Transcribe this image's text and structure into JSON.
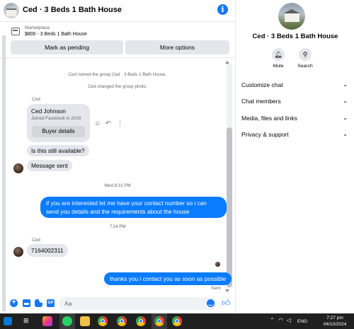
{
  "header": {
    "title": "Ced · 3 Beds 1 Bath House",
    "info_icon": "i"
  },
  "marketplace": {
    "label": "Marketplace",
    "listing": "$800 - 3 Beds 1 Bath House",
    "pending_button": "Mark as pending",
    "more_button": "More options"
  },
  "messages": {
    "system1": "Ced named the group Ced · 3 Beds 1 Bath House.",
    "system2": "Ced changed the group photo.",
    "sender1": "Ced",
    "card_name": "Ced Johnson",
    "card_sub": "Joined Facebook in 2019",
    "card_button": "Buyer details",
    "msg_available": "Is this still available?",
    "msg_sent": "Message sent",
    "time1": "Wed 8:31 PM",
    "out1": "if you are interested let me have your contact number so i can send you details and the requirements about the house",
    "time2": "7:24 PM",
    "sender2": "Ced",
    "msg_number": "7164002311",
    "out2": "thanks you i contact you as soon as possible",
    "status": "Sent"
  },
  "composer": {
    "placeholder": "Aa"
  },
  "panel": {
    "title": "Ced · 3 Beds 1 Bath House",
    "mute_label": "Mute",
    "search_label": "Search",
    "sections": [
      "Customize chat",
      "Chat members",
      "Media, files and links",
      "Privacy & support"
    ]
  },
  "taskbar": {
    "lang": "ENG",
    "time": "7:27 pm",
    "date": "04/10/2024"
  },
  "colors": {
    "accent": "#0a7cff",
    "brand": "#1877f2",
    "bubble_in": "#e4e6eb",
    "taskbar": "#202020"
  }
}
